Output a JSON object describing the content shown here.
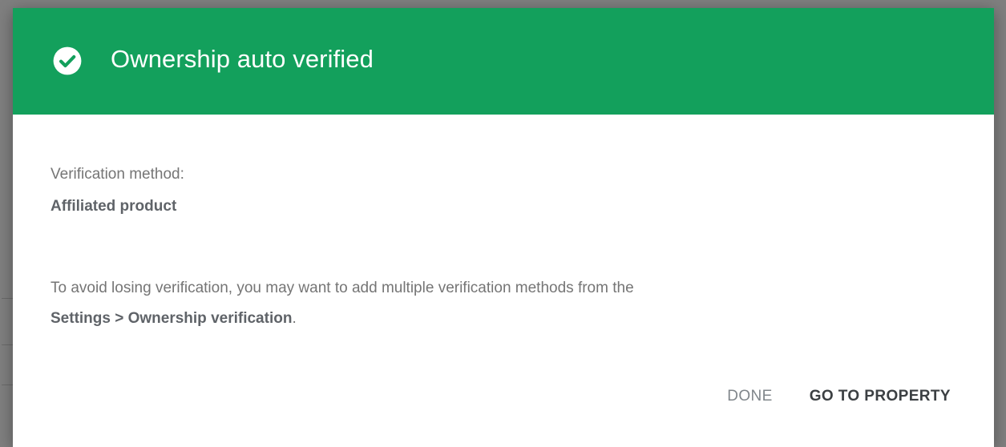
{
  "dialog": {
    "title": "Ownership auto verified",
    "icon": "check-circle-icon",
    "header_color": "#13A05C",
    "method_label": "Verification method:",
    "method_value": "Affiliated product",
    "advice_text": "To avoid losing verification, you may want to add multiple verification methods from the",
    "advice_link": "Settings > Ownership verification",
    "advice_end": ".",
    "buttons": {
      "done": "DONE",
      "go_to_property": "GO TO PROPERTY"
    }
  }
}
